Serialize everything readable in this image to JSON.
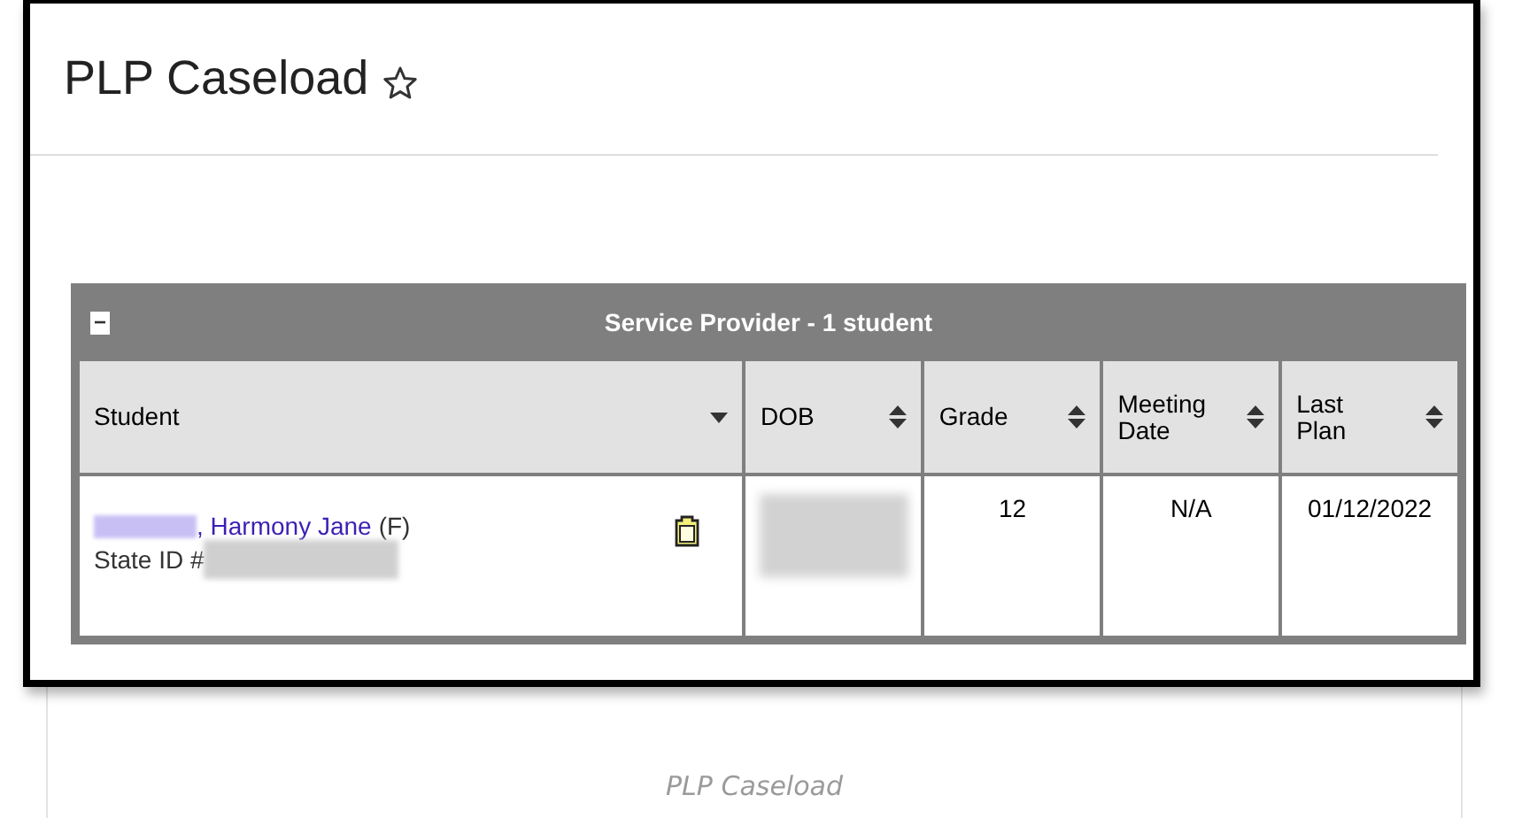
{
  "page": {
    "title": "PLP Caseload",
    "favorite": false
  },
  "table": {
    "caption": "Service Provider - 1 student",
    "collapse_icon": "−",
    "columns": [
      {
        "label": "Student",
        "sorted": true
      },
      {
        "label": "DOB",
        "sorted": false
      },
      {
        "label": "Grade",
        "sorted": false
      },
      {
        "label": "Meeting Date",
        "sorted": false
      },
      {
        "label": "Last Plan",
        "sorted": false
      }
    ],
    "rows": [
      {
        "name": ", Harmony Jane",
        "gender": "(F)",
        "state_id_label": "State ID #",
        "grade": "12",
        "meeting_date": "N/A",
        "last_plan": "01/12/2022"
      }
    ]
  },
  "caption": "PLP Caseload"
}
